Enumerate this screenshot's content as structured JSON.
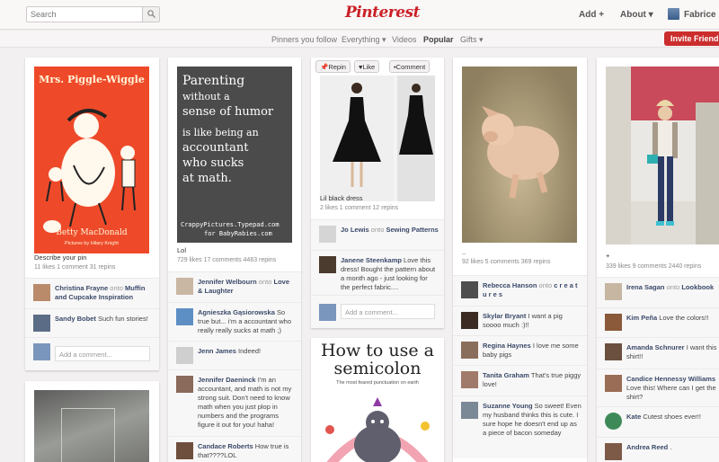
{
  "header": {
    "search_placeholder": "Search",
    "logo": "Pinterest",
    "add": "Add +",
    "about": "About ▾",
    "user": "Fabrice"
  },
  "subnav": {
    "items": [
      "Pinners you follow",
      "Everything ▾",
      "Videos",
      "Popular",
      "Gifts ▾"
    ],
    "invite": "Invite Friends"
  },
  "pins": {
    "p1": {
      "img_title": "Mrs. Piggle-Wiggle",
      "img_author": "Betty MacDonald",
      "img_illus": "Pictures by Hilary Knight",
      "desc": "Describe your pin",
      "stats": "11 likes  1 comment  31 repins",
      "c1_name": "Christina Frayne",
      "c1_onto": "onto",
      "c1_board": "Muffin and Cupcake Inspiration",
      "c2_name": "Sandy Bobet",
      "c2_text": "Such fun stories!",
      "add": "Add a comment..."
    },
    "p2": {
      "quote": [
        "Parenting",
        "without a",
        "sense of humor",
        "is like being an",
        "accountant",
        "who sucks",
        "at math."
      ],
      "credit1": "CrappyPictures.Typepad.com",
      "credit2": "for BabyRabies.com",
      "desc": "Lol",
      "stats": "729 likes  17 comments  4463 repins",
      "c1_name": "Jennifer Welbourn",
      "c1_onto": "onto",
      "c1_board": "Love & Laughter",
      "c2_name": "Agnieszka Gąsiorowska",
      "c2_text": "So true but... i'm a accountant who really really sucks at math ;)",
      "c3_name": "Jenn James",
      "c3_text": "Indeed!",
      "c4_name": "Jennifer Daeninck",
      "c4_text": "I'm an accountant, and math is not my strong suit. Don't need to know math when you just plop in numbers and the programs figure it out for you! haha!",
      "c5_name": "Candace Roberts",
      "c5_text": "How true is that????LOL"
    },
    "p3": {
      "repin": "Repin",
      "like": "Like",
      "comment": "Comment",
      "desc": "Lil black dress",
      "stats": "2 likes  1 comment  12 repins",
      "c1_name": "Jo Lewis",
      "c1_onto": "onto",
      "c1_board": "Sewing Patterns",
      "c2_name": "Janene Steenkamp",
      "c2_text": "Love this dress! Bought the pattern about a month ago - just looking for the perfect fabric....",
      "add": "Add a comment..."
    },
    "p4": {
      "title": "How to use a semicolon",
      "sub": "The most feared punctuation on earth"
    },
    "p5": {
      "desc": "..",
      "stats": "92 likes  5 comments  369 repins",
      "c1_name": "Rebecca Hanson",
      "c1_onto": "onto",
      "c1_board": "c r e a t u r e s",
      "c2_name": "Skylar Bryant",
      "c2_text": "I want a pig soooo much :)!!",
      "c3_name": "Regina Haynes",
      "c3_text": "I love me some baby pigs",
      "c4_name": "Tanita Graham",
      "c4_text": "That's true piggy love!",
      "c5_name": "Suzanne Young",
      "c5_text": "So sweet! Even my husband thinks this is cute. I sure hope he doesn't end up as a piece of bacon someday"
    },
    "p6": {
      "desc": "+",
      "stats": "339 likes  9 comments  2440 repins",
      "c1_name": "Irena Sagan",
      "c1_onto": "onto",
      "c1_board": "Lookbook",
      "c2_name": "Kim Peña",
      "c2_text": "Love the colors!!",
      "c3_name": "Amanda Schnurer",
      "c3_text": "I want this shirt!!",
      "c4_name": "Candice Hennessy Williams",
      "c4_text": "Love this! Where can I get the shirt?",
      "c5_name": "Kate",
      "c5_text": "Cutest shoes ever!!",
      "c6_name": "Andrea Reed",
      "c6_text": "."
    }
  }
}
